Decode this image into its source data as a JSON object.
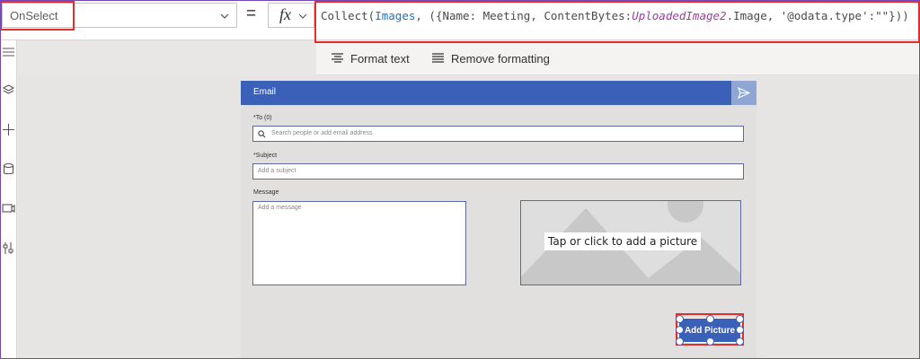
{
  "formula_bar": {
    "property": "OnSelect",
    "equals": "=",
    "fx_label": "fx",
    "formula": {
      "fn": "Collect(",
      "collection": "Images",
      "mid1": ", ({Name: Meeting, ContentBytes:",
      "control": "UploadedImage2",
      "mid2": ".Image, '@odata.type':\"\"}))"
    }
  },
  "format_toolbar": {
    "format_text": "Format text",
    "remove_formatting": "Remove formatting"
  },
  "left_rail": {
    "icons": [
      "tree-view-icon",
      "layers-icon",
      "insert-icon",
      "data-icon",
      "media-icon",
      "advanced-tools-icon"
    ]
  },
  "screen": {
    "header_title": "Email",
    "to_label": "*To (0)",
    "to_placeholder": "Search people or add email address",
    "subject_label": "*Subject",
    "subject_placeholder": "Add a subject",
    "message_label": "Message",
    "message_placeholder": "Add a message",
    "picture_caption": "Tap or click to add a picture",
    "add_picture_button": "Add Picture"
  },
  "colors": {
    "accent": "#3a60b8",
    "highlight": "#e0302e",
    "formula_keyword": "#1e72b8",
    "formula_variable": "#a33aa0"
  }
}
